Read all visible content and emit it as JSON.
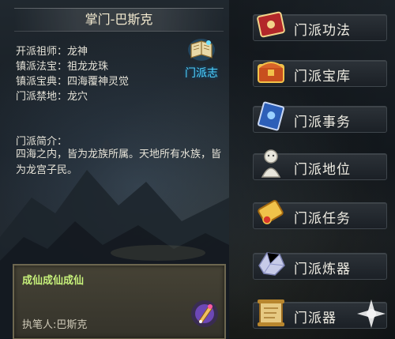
{
  "panel": {
    "title": "掌门-巴斯克",
    "info": [
      {
        "label": "开派祖师：",
        "value": "龙神"
      },
      {
        "label": "镇派法宝：",
        "value": "祖龙龙珠"
      },
      {
        "label": "镇派宝典：",
        "value": "四海覆神灵觉"
      },
      {
        "label": "门派禁地：",
        "value": "龙穴"
      }
    ],
    "chronicle_label": "门派志",
    "intro_title": "门派简介：",
    "intro_text": "四海之内，皆为龙族所属。天地所有水族，皆为龙宫子民。"
  },
  "note": {
    "text": "成仙成仙成仙",
    "author": "执笔人:巴斯克"
  },
  "menu": {
    "items": [
      {
        "label": "门派功法",
        "icon": "red-book-icon"
      },
      {
        "label": "门派宝库",
        "icon": "treasure-chest-icon"
      },
      {
        "label": "门派事务",
        "icon": "blue-scroll-icon"
      },
      {
        "label": "门派地位",
        "icon": "jade-figure-icon"
      },
      {
        "label": "门派任务",
        "icon": "golden-scroll-icon"
      },
      {
        "label": "门派炼器",
        "icon": "crystal-ore-icon"
      },
      {
        "label": "门派器",
        "icon": "map-scroll-icon"
      }
    ]
  },
  "colors": {
    "accent_blue": "#4fd3ff",
    "note_green": "#c6f07a",
    "text_light": "#e6e3d8"
  }
}
